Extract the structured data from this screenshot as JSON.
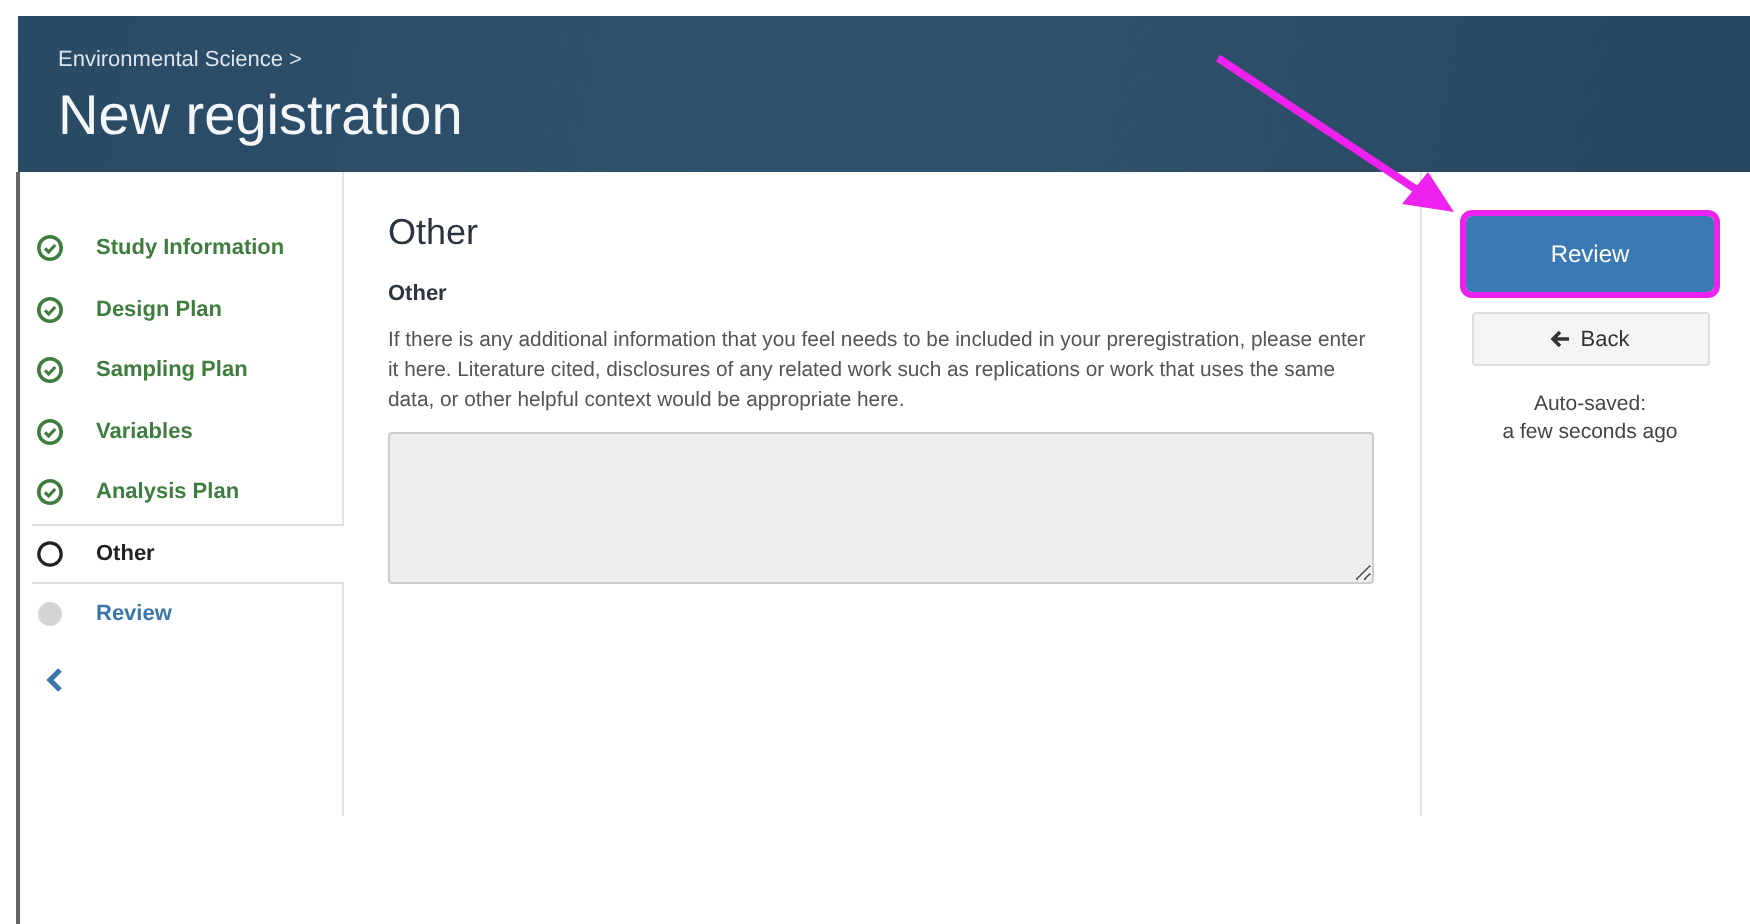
{
  "header": {
    "breadcrumb": "Environmental Science >",
    "title": "New registration"
  },
  "steps": [
    {
      "label": "Study Information",
      "completed": true,
      "selected": false
    },
    {
      "label": "Design Plan",
      "completed": true,
      "selected": false
    },
    {
      "label": "Sampling Plan",
      "completed": true,
      "selected": false
    },
    {
      "label": "Variables",
      "completed": true,
      "selected": false
    },
    {
      "label": "Analysis Plan",
      "completed": true,
      "selected": false
    },
    {
      "label": "Other",
      "completed": false,
      "selected": true
    },
    {
      "label": "Review",
      "completed": false,
      "selected": false
    }
  ],
  "main": {
    "heading": "Other",
    "field_label": "Other",
    "help": "If there is any additional information that you feel needs to be included in your preregistration, please enter it here. Literature cited, disclosures of any related work such as replications or work that uses the same data, or other helpful context would be appropriate here."
  },
  "actions": {
    "review_button": {
      "label": "Review",
      "highlighted": true
    },
    "back_button": {
      "label": "Back"
    },
    "autosave": [
      "Auto-saved:",
      "a few seconds ago"
    ]
  }
}
